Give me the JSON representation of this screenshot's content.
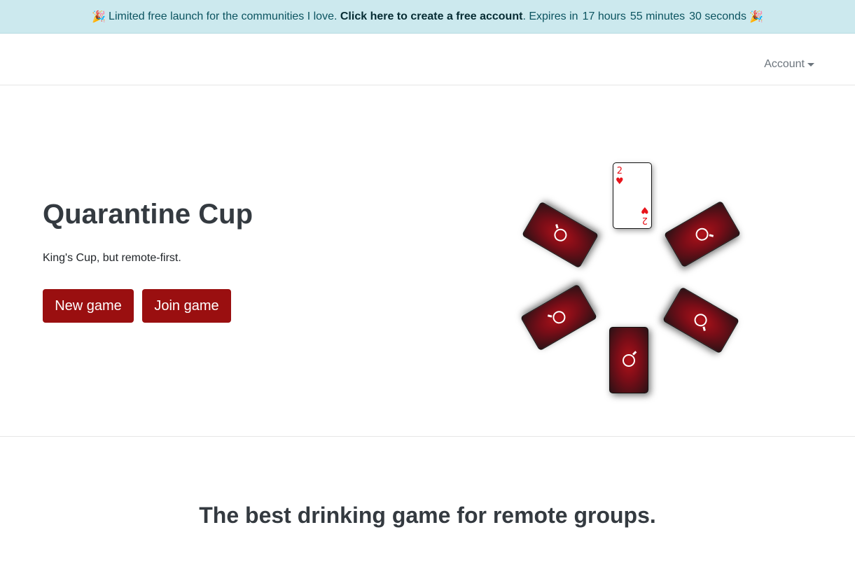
{
  "banner": {
    "party_emoji": "🎉",
    "text_before": "Limited free launch for the communities I love.",
    "link_text": "Click here to create a free account",
    "expires_label": ". Expires in",
    "hours": "17 hours",
    "minutes": "55 minutes",
    "seconds": "30 seconds",
    "background_color": "#cce9ee"
  },
  "nav": {
    "account_label": "Account"
  },
  "hero": {
    "title": "Quarantine Cup",
    "subtitle": "King's Cup, but remote-first.",
    "new_game_label": "New game",
    "join_game_label": "Join game",
    "button_color": "#9a0f10"
  },
  "cards": {
    "face_card": {
      "rank": "2",
      "suit": "♥",
      "suit_color": "#e8141b"
    },
    "back_logo_icon": "refresh-icon",
    "back_color": "#9a0f10"
  },
  "section": {
    "tagline": "The best drinking game for remote groups."
  }
}
